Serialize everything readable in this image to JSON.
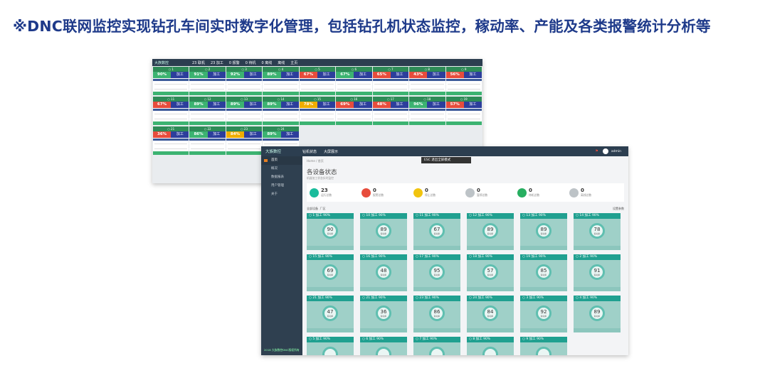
{
  "headline": "※DNC联网监控实现钻孔车间实时数字化管理，包括钻孔机状态监控，稼动率、产能及各类报警统计分析等",
  "screen1": {
    "brand": "大族数控",
    "nav": [
      "23 联机",
      "23 加工",
      "0 报警",
      "0 待机",
      "0 离线",
      "离线",
      "主页"
    ],
    "popup": "ESC 退出全屏模式",
    "machines": [
      {
        "id": "1",
        "pct": "90%",
        "state": "加工",
        "color": "#3cb371"
      },
      {
        "id": "2",
        "pct": "91%",
        "state": "加工",
        "color": "#3cb371"
      },
      {
        "id": "3",
        "pct": "92%",
        "state": "加工",
        "color": "#3cb371"
      },
      {
        "id": "4",
        "pct": "89%",
        "state": "加工",
        "color": "#3cb371"
      },
      {
        "id": "5",
        "pct": "67%",
        "state": "加工",
        "color": "#e74c3c"
      },
      {
        "id": "6",
        "pct": "67%",
        "state": "加工",
        "color": "#3cb371"
      },
      {
        "id": "7",
        "pct": "65%",
        "state": "加工",
        "color": "#e74c3c"
      },
      {
        "id": "8",
        "pct": "43%",
        "state": "加工",
        "color": "#e74c3c"
      },
      {
        "id": "9",
        "pct": "56%",
        "state": "加工",
        "color": "#e74c3c"
      },
      {
        "id": "11",
        "pct": "67%",
        "state": "加工",
        "color": "#e74c3c"
      },
      {
        "id": "12",
        "pct": "89%",
        "state": "加工",
        "color": "#3cb371"
      },
      {
        "id": "13",
        "pct": "89%",
        "state": "加工",
        "color": "#3cb371"
      },
      {
        "id": "14",
        "pct": "89%",
        "state": "加工",
        "color": "#3cb371"
      },
      {
        "id": "15",
        "pct": "78%",
        "state": "加工",
        "color": "#f0ad00"
      },
      {
        "id": "16",
        "pct": "69%",
        "state": "加工",
        "color": "#e74c3c"
      },
      {
        "id": "17",
        "pct": "48%",
        "state": "加工",
        "color": "#e74c3c"
      },
      {
        "id": "18",
        "pct": "96%",
        "state": "加工",
        "color": "#3cb371"
      },
      {
        "id": "19",
        "pct": "57%",
        "state": "加工",
        "color": "#e74c3c"
      },
      {
        "id": "21",
        "pct": "36%",
        "state": "加工",
        "color": "#e74c3c"
      },
      {
        "id": "22",
        "pct": "86%",
        "state": "加工",
        "color": "#3cb371"
      },
      {
        "id": "23",
        "pct": "84%",
        "state": "加工",
        "color": "#f0ad00"
      },
      {
        "id": "24",
        "pct": "89%",
        "state": "加工",
        "color": "#3cb371"
      }
    ]
  },
  "screen2": {
    "brand": "大族数控",
    "tabs": [
      "钻机状态",
      "大屏展示"
    ],
    "user": "admin",
    "popup": "ESC 退出全屏模式",
    "sidebar": [
      "首页",
      "概况",
      "数据报表",
      "用户管理",
      "关于"
    ],
    "footer": "2018 大族数控DNC版权所有",
    "crumb": "Home / 首页",
    "title": "各设备状态",
    "subtitle": "机器加工状态实时监控",
    "stats": [
      {
        "num": "23",
        "label": "运行总数",
        "color": "#1abc9c",
        "icon": "play-icon"
      },
      {
        "num": "0",
        "label": "报警总数",
        "color": "#e74c3c",
        "icon": "alarm-icon"
      },
      {
        "num": "0",
        "label": "停止总数",
        "color": "#f1c40f",
        "icon": "stop-icon"
      },
      {
        "num": "0",
        "label": "暂停总数",
        "color": "#bdc3c7",
        "icon": "pause-icon"
      },
      {
        "num": "0",
        "label": "待机总数",
        "color": "#27ae60",
        "icon": "standby-icon"
      },
      {
        "num": "0",
        "label": "离线总数",
        "color": "#bdc3c7",
        "icon": "offline-icon"
      }
    ],
    "filter_left": "全部设备",
    "filter_mid": "厂区",
    "filter_right": "设置参数",
    "ring_label": "稼动率",
    "machines": [
      {
        "hd": "1 加工 90%",
        "v": "90"
      },
      {
        "hd": "10 加工 90%",
        "v": "89"
      },
      {
        "hd": "11 加工 90%",
        "v": "67"
      },
      {
        "hd": "12 加工 90%",
        "v": "89"
      },
      {
        "hd": "13 加工 90%",
        "v": "89"
      },
      {
        "hd": "14 加工 90%",
        "v": "78"
      },
      {
        "hd": "15 加工 90%",
        "v": "69"
      },
      {
        "hd": "16 加工 90%",
        "v": "48"
      },
      {
        "hd": "17 加工 90%",
        "v": "95"
      },
      {
        "hd": "18 加工 90%",
        "v": "57"
      },
      {
        "hd": "19 加工 90%",
        "v": "85"
      },
      {
        "hd": "2 加工 90%",
        "v": "91"
      },
      {
        "hd": "21 加工 90%",
        "v": "47"
      },
      {
        "hd": "21 加工 90%",
        "v": "36"
      },
      {
        "hd": "23 加工 90%",
        "v": "86"
      },
      {
        "hd": "24 加工 90%",
        "v": "84"
      },
      {
        "hd": "3 加工 90%",
        "v": "92"
      },
      {
        "hd": "4 加工 90%",
        "v": "89"
      },
      {
        "hd": "5 加工 90%",
        "v": ""
      },
      {
        "hd": "6 加工 90%",
        "v": ""
      },
      {
        "hd": "7 加工 90%",
        "v": ""
      },
      {
        "hd": "8 加工 90%",
        "v": ""
      },
      {
        "hd": "9 加工 90%",
        "v": ""
      }
    ]
  }
}
